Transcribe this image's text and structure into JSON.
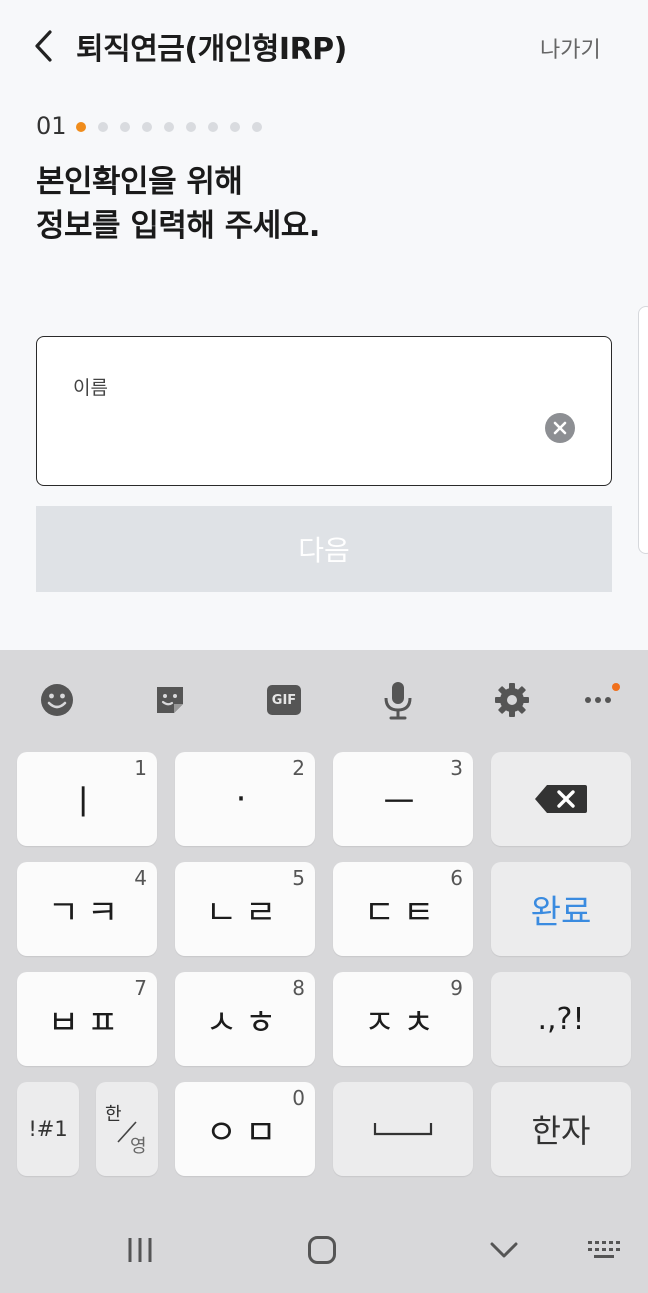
{
  "header": {
    "title": "퇴직연금(개인형IRP)",
    "exit_label": "나가기",
    "back_icon": "chevron-left-icon"
  },
  "stepper": {
    "current": "01",
    "total_dots": 9,
    "active_index": 0,
    "active_color": "#f08c1c"
  },
  "heading": {
    "line1": "본인확인을 위해",
    "line2": "정보를 입력해 주세요."
  },
  "name_field": {
    "label": "이름",
    "value": "",
    "clear_icon": "clear-icon"
  },
  "next_button": {
    "label": "다음",
    "enabled": false
  },
  "keyboard": {
    "toolbar": [
      "emoji-icon",
      "sticker-icon",
      "gif-icon",
      "microphone-icon",
      "settings-gear-icon",
      "more-icon"
    ],
    "gif_label": "GIF",
    "rows": {
      "r1": {
        "k1": {
          "char": "ㅣ",
          "num": "1"
        },
        "k2": {
          "char": "·",
          "num": "2"
        },
        "k3": {
          "char": "ㅡ",
          "num": "3"
        }
      },
      "r2": {
        "k1": {
          "char": "ㄱㅋ",
          "num": "4"
        },
        "k2": {
          "char": "ㄴㄹ",
          "num": "5"
        },
        "k3": {
          "char": "ㄷㅌ",
          "num": "6"
        },
        "done": "완료"
      },
      "r3": {
        "k1": {
          "char": "ㅂㅍ",
          "num": "7"
        },
        "k2": {
          "char": "ㅅㅎ",
          "num": "8"
        },
        "k3": {
          "char": "ㅈㅊ",
          "num": "9"
        },
        "punct": ".,?!"
      },
      "r4": {
        "symbols": "!#1",
        "lang_top": "한",
        "lang_bottom": "영",
        "k0": {
          "char": "ㅇㅁ",
          "num": "0"
        },
        "hanja": "한자"
      }
    },
    "accent_color": "#3a8be0"
  },
  "navbar": [
    "recent-apps-icon",
    "home-icon",
    "back-chevron-down-icon",
    "keyboard-icon"
  ]
}
